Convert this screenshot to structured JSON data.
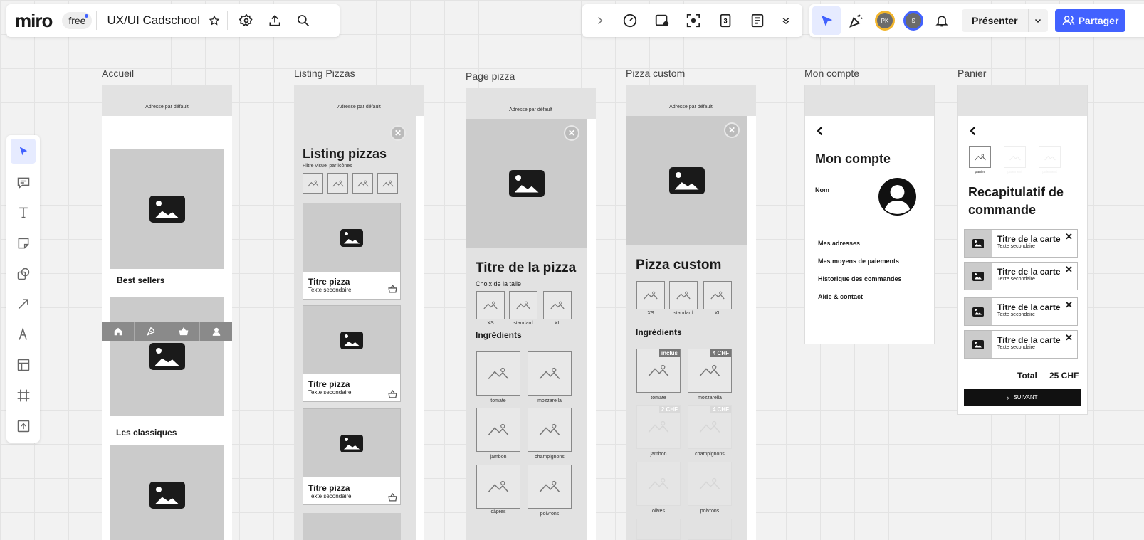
{
  "app": {
    "logo": "miro",
    "plan": "free",
    "board_title": "UX/UI Cadschool"
  },
  "top_right": {
    "avatar_pk": "PK",
    "avatar_s": "S",
    "present_label": "Présenter",
    "share_label": "Partager"
  },
  "frames": {
    "accueil": {
      "label": "Accueil",
      "header": "Adresse par défault",
      "section1": "Best sellers",
      "section2": "Les classiques"
    },
    "listing": {
      "label": "Listing Pizzas",
      "header": "Adresse par défault",
      "title": "Listing pizzas",
      "filter_caption": "Filtre visuel par icônes",
      "cards": [
        {
          "title": "Titre pizza",
          "subtitle": "Texte secondaire"
        },
        {
          "title": "Titre pizza",
          "subtitle": "Texte secondaire"
        },
        {
          "title": "Titre pizza",
          "subtitle": "Texte secondaire"
        }
      ]
    },
    "page_pizza": {
      "label": "Page pizza",
      "header": "Adresse par défault",
      "title": "Titre de la pizza",
      "size_caption": "Choix de la taile",
      "sizes": [
        "XS",
        "standard",
        "XL"
      ],
      "ingredients_title": "Ingrédients",
      "ingredients": [
        "tomate",
        "mozzarella",
        "jambon",
        "champignons",
        "câpres",
        "poivrons"
      ]
    },
    "custom": {
      "label": "Pizza custom",
      "header": "Adresse par défault",
      "title": "Pizza custom",
      "sizes": [
        "XS",
        "standard",
        "XL"
      ],
      "ingredients_title": "Ingrédients",
      "ingredients": [
        {
          "name": "tomate",
          "badge": "inclus"
        },
        {
          "name": "mozzarella",
          "badge": "4 CHF"
        },
        {
          "name": "jambon",
          "badge": "2 CHF"
        },
        {
          "name": "champignons",
          "badge": "4 CHF"
        },
        {
          "name": "olives",
          "badge": ""
        },
        {
          "name": "poivrons",
          "badge": ""
        }
      ]
    },
    "compte": {
      "label": "Mon compte",
      "title": "Mon compte",
      "name_label": "Nom",
      "links": [
        "Mes adresses",
        "Mes moyens de paiements",
        "Historique des commandes",
        "Aide & contact"
      ]
    },
    "panier": {
      "label": "Panier",
      "step1": "panier",
      "step2": "paiement",
      "step3": "paiement",
      "title": "Recapitulatif de commande",
      "items": [
        {
          "title": "Titre de la carte",
          "subtitle": "Texte secondaire"
        },
        {
          "title": "Titre de la carte",
          "subtitle": "Texte secondaire"
        },
        {
          "title": "Titre de la carte",
          "subtitle": "Texte secondaire"
        },
        {
          "title": "Titre de la carte",
          "subtitle": "Texte secondaire"
        }
      ],
      "total_label": "Total",
      "total_value": "25 CHF",
      "next_label": "SUIVANT"
    }
  },
  "colors": {
    "accent": "#4262ff",
    "active_tool_bg": "#e6ebff",
    "avatar_pk": "#f2b52c",
    "avatar_s": "#4262ff"
  }
}
